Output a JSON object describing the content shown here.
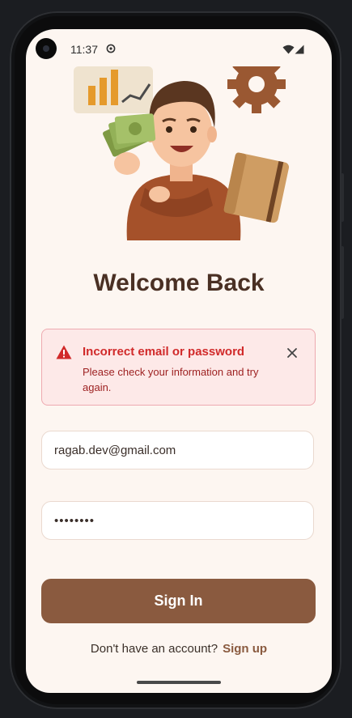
{
  "status_bar": {
    "time": "11:37"
  },
  "screen": {
    "title": "Welcome Back"
  },
  "alert": {
    "title": "Incorrect email or password",
    "message": "Please check your information and try again."
  },
  "form": {
    "email_value": "ragab.dev@gmail.com",
    "password_value": "••••••••",
    "sign_in_label": "Sign In"
  },
  "footer": {
    "prompt": "Don't have an account?",
    "link": "Sign up"
  },
  "colors": {
    "background": "#fdf6f1",
    "title": "#4a3024",
    "primary_button": "#8a5a3f",
    "error": "#d12a2a",
    "error_background": "#fde9e8"
  }
}
